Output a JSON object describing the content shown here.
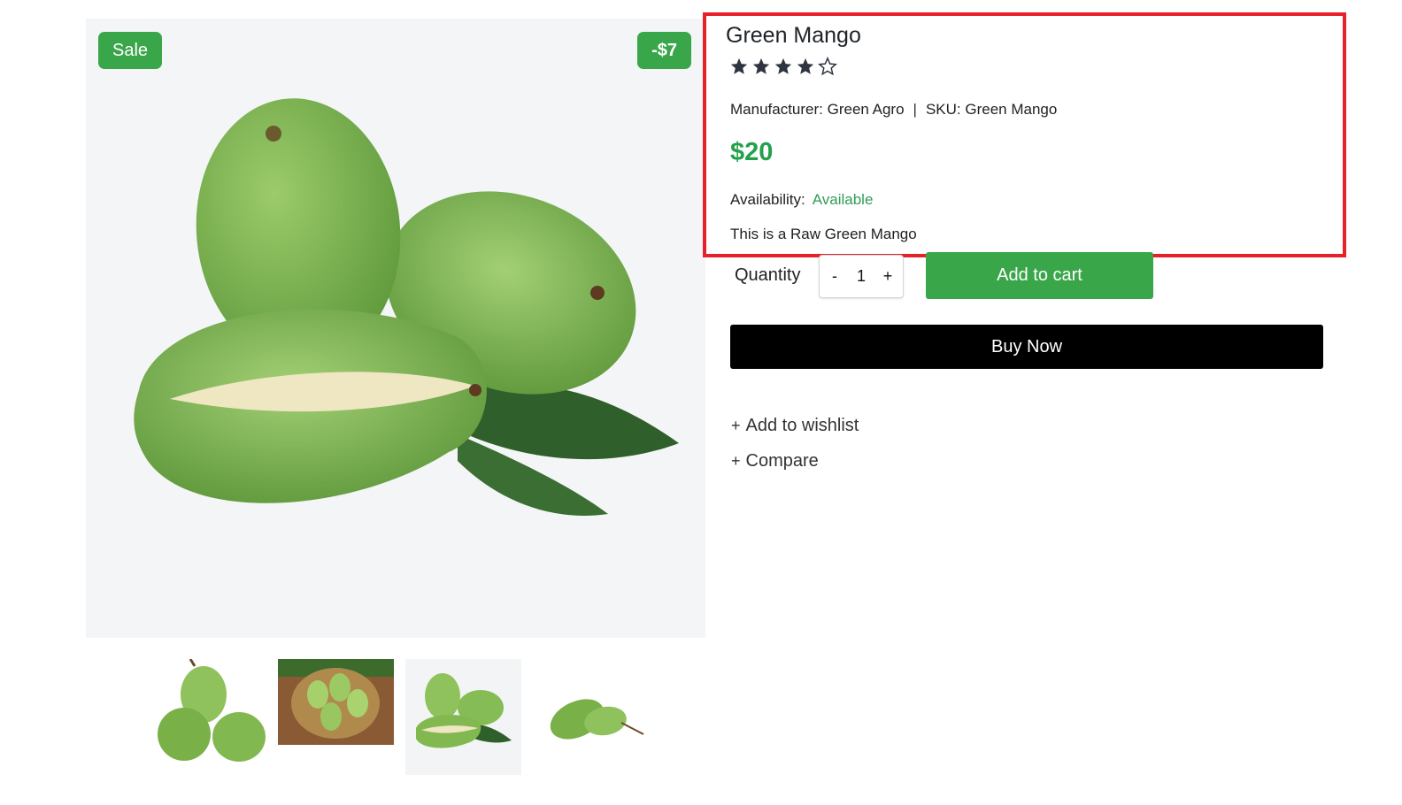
{
  "gallery": {
    "sale_badge": "Sale",
    "discount_badge": "-$7"
  },
  "product": {
    "title": "Green Mango",
    "rating": 4,
    "rating_max": 5,
    "manufacturer": "Manufacturer: Green Agro",
    "separator": "|",
    "sku": "SKU: Green Mango",
    "price": "$20",
    "availability_label": "Availability:",
    "availability_status": "Available",
    "description": "This is a Raw Green Mango"
  },
  "purchase": {
    "quantity_label": "Quantity",
    "decrement": "-",
    "quantity": "1",
    "increment": "+",
    "add_to_cart": "Add to cart",
    "buy_now": "Buy Now"
  },
  "actions": {
    "plus": "+",
    "wishlist": "Add to wishlist",
    "compare": "Compare"
  },
  "colors": {
    "accent_green": "#3aa64a",
    "price_green": "#22a14a",
    "highlight_red": "#e8202a"
  }
}
